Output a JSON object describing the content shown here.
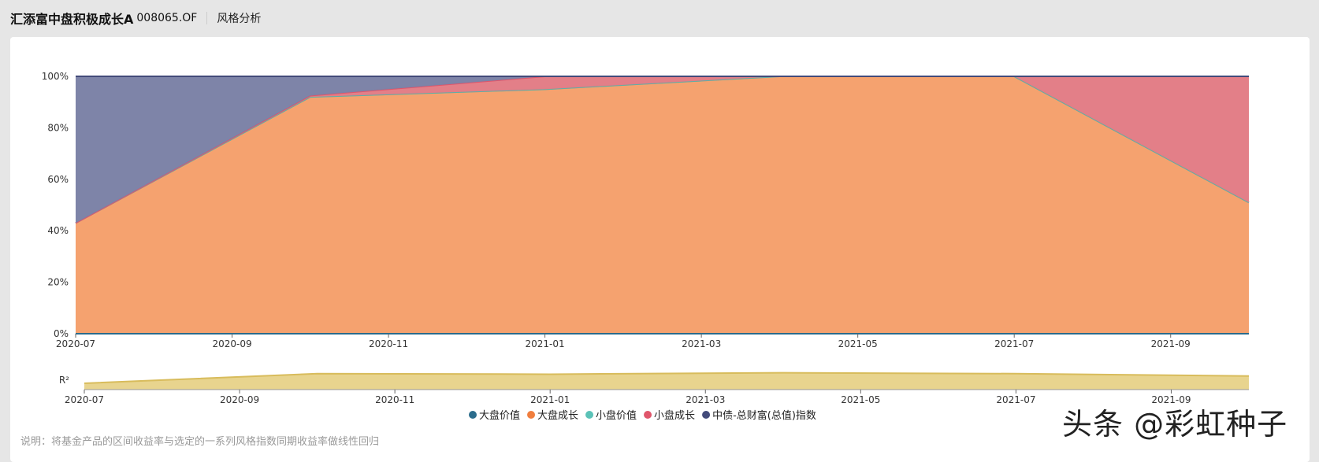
{
  "header": {
    "fund_name": "汇添富中盘积极成长A",
    "fund_code": "008065.OF",
    "tab": "风格分析"
  },
  "note": "说明：将基金产品的区间收益率与选定的一系列风格指数同期收益率做线性回归",
  "watermark": "头条 @彩虹种子",
  "colors": {
    "large_value": "#2b6c8c",
    "large_growth": "#f07e3e",
    "small_value": "#5bc2b7",
    "small_growth": "#e0566b",
    "bond": "#434b7a"
  },
  "chart_data": [
    {
      "type": "area",
      "stacked": true,
      "title": "",
      "x": [
        "2020-07",
        "2020-10",
        "2021-01",
        "2021-04",
        "2021-07",
        "2021-10"
      ],
      "x_ticks": [
        "2020-07",
        "2020-09",
        "2020-11",
        "2021-01",
        "2021-03",
        "2021-05",
        "2021-07",
        "2021-09"
      ],
      "y_ticks": [
        "0%",
        "20%",
        "40%",
        "60%",
        "80%",
        "100%"
      ],
      "ylim": [
        0,
        100
      ],
      "series": [
        {
          "name": "大盘价值",
          "values": [
            0,
            0,
            0,
            0,
            0,
            0
          ]
        },
        {
          "name": "大盘成长",
          "values": [
            43,
            92,
            95,
            100,
            100,
            51
          ]
        },
        {
          "name": "小盘价值",
          "values": [
            0,
            0,
            0,
            0,
            0,
            0
          ]
        },
        {
          "name": "小盘成长",
          "values": [
            0,
            0.5,
            5,
            0,
            0,
            49
          ]
        },
        {
          "name": "中债-总财富(总值)指数",
          "values": [
            57,
            7.5,
            0,
            0,
            0,
            0
          ]
        }
      ],
      "legend_position": "bottom"
    },
    {
      "type": "area",
      "ylabel": "R²",
      "x": [
        "2020-07",
        "2020-10",
        "2021-01",
        "2021-04",
        "2021-07",
        "2021-10"
      ],
      "values": [
        0.35,
        0.88,
        0.85,
        0.93,
        0.88,
        0.75
      ],
      "ylim": [
        0,
        1
      ]
    }
  ]
}
